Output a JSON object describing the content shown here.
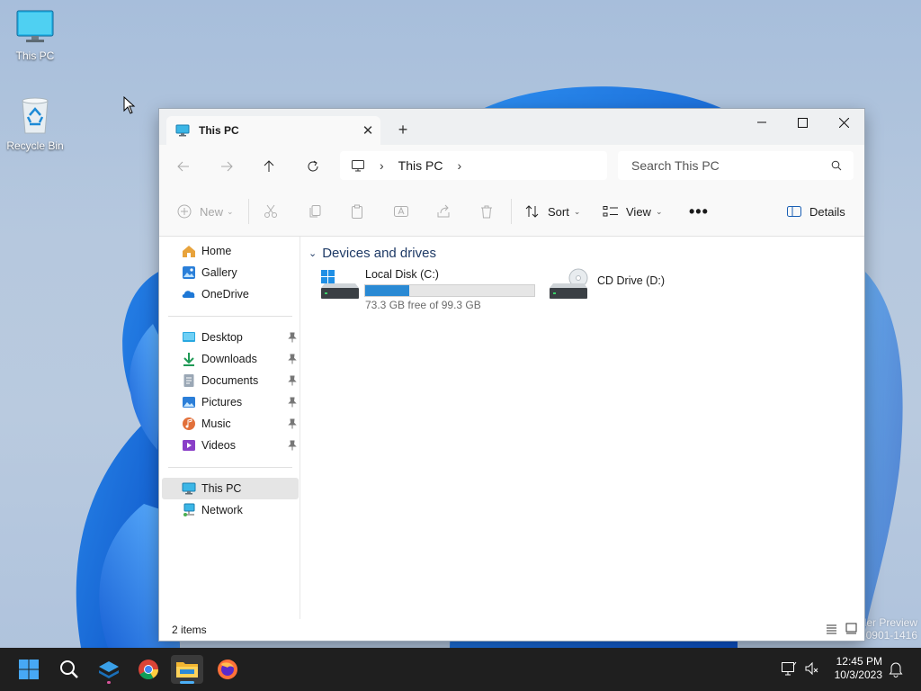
{
  "desktop": {
    "icons": [
      {
        "label": "This PC"
      },
      {
        "label": "Recycle Bin"
      }
    ],
    "watermark_line1": "der Preview",
    "watermark_line2": "30901-1416"
  },
  "window": {
    "tab_title": "This PC",
    "address": {
      "segment": "This PC"
    },
    "search_placeholder": "Search This PC",
    "toolbar": {
      "new_label": "New",
      "sort_label": "Sort",
      "view_label": "View",
      "details_label": "Details"
    },
    "sidebar": {
      "top": [
        {
          "label": "Home"
        },
        {
          "label": "Gallery"
        },
        {
          "label": "OneDrive"
        }
      ],
      "pinned": [
        {
          "label": "Desktop"
        },
        {
          "label": "Downloads"
        },
        {
          "label": "Documents"
        },
        {
          "label": "Pictures"
        },
        {
          "label": "Music"
        },
        {
          "label": "Videos"
        }
      ],
      "bottom": [
        {
          "label": "This PC",
          "selected": true
        },
        {
          "label": "Network"
        }
      ]
    },
    "group_header": "Devices and drives",
    "drives": [
      {
        "name": "Local Disk (C:)",
        "free_text": "73.3 GB free of 99.3 GB",
        "used_fraction": 0.262
      },
      {
        "name": "CD Drive (D:)"
      }
    ],
    "status_items": "2 items"
  },
  "taskbar": {
    "apps": [
      "start-icon",
      "search-icon",
      "widgets-icon",
      "chrome-icon",
      "file-explorer-icon",
      "firefox-icon"
    ],
    "time": "12:45 PM",
    "date": "10/3/2023"
  },
  "colors": {
    "accent": "#0078d4",
    "taskbar": "#1f1f1f",
    "drive_bar_fill": "#2a8ad4"
  }
}
